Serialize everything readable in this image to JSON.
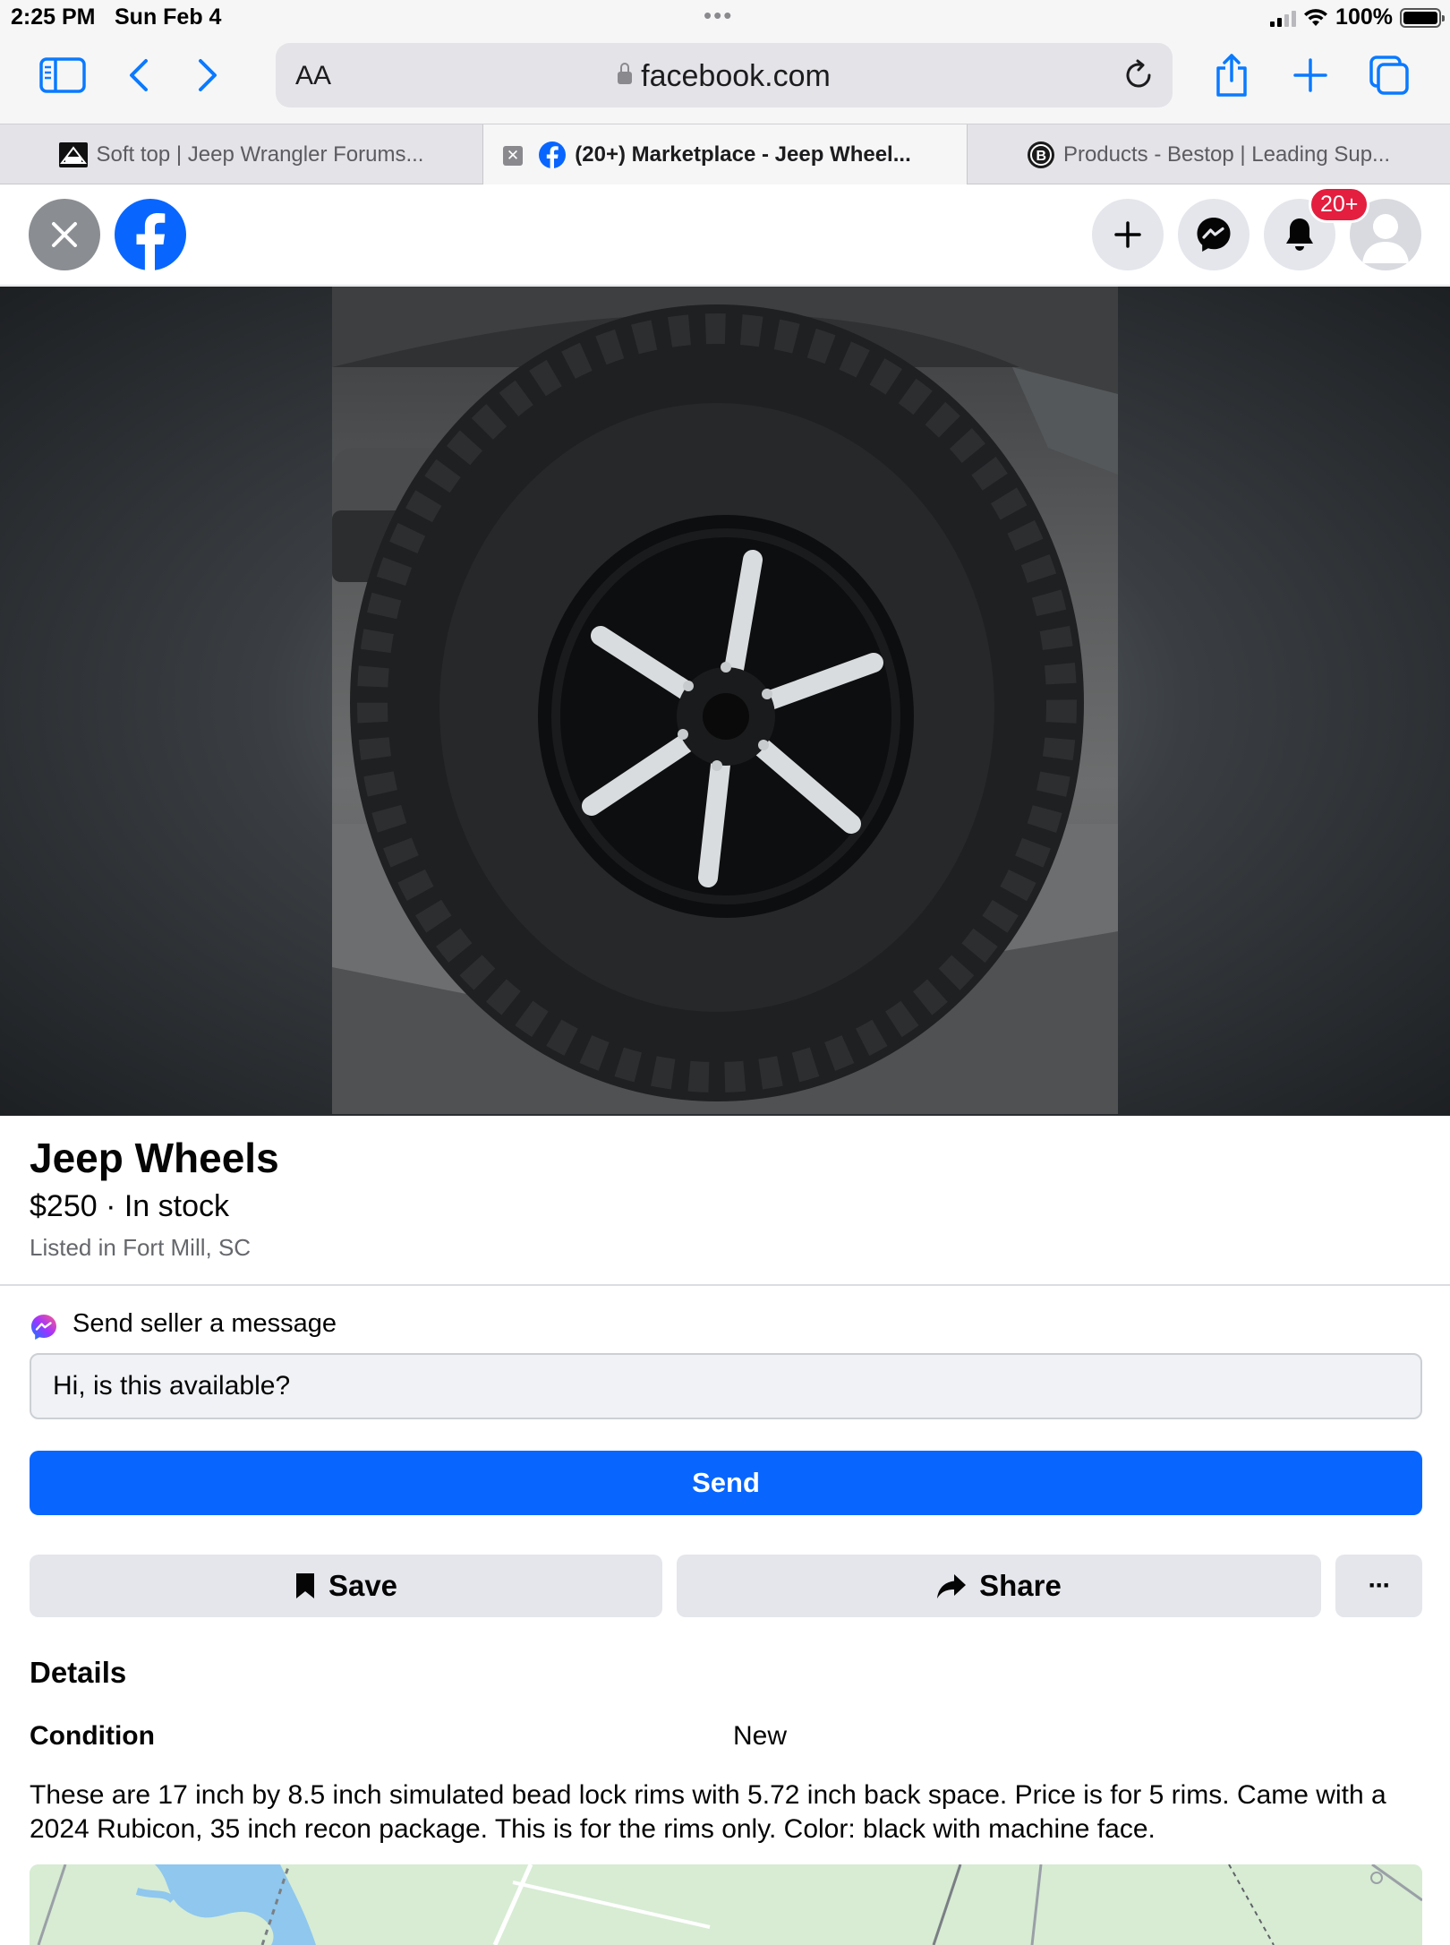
{
  "status_bar": {
    "time": "2:25 PM",
    "date": "Sun Feb 4",
    "battery": "100%"
  },
  "browser": {
    "text_size_label": "AA",
    "url": "facebook.com",
    "tabs": [
      {
        "label": "Soft top | Jeep Wrangler Forums...",
        "active": false
      },
      {
        "label": "(20+) Marketplace - Jeep Wheel...",
        "active": true
      },
      {
        "label": "Products - Bestop | Leading Sup...",
        "active": false
      }
    ]
  },
  "fb_header": {
    "notification_badge": "20+"
  },
  "listing": {
    "title": "Jeep Wheels",
    "price_status": "$250 · In stock",
    "location": "Listed in Fort Mill, SC"
  },
  "message": {
    "label": "Send seller a message",
    "input_value": "Hi, is this available?",
    "send_label": "Send"
  },
  "actions": {
    "save_label": "Save",
    "share_label": "Share",
    "more_label": "···"
  },
  "details": {
    "heading": "Details",
    "condition_label": "Condition",
    "condition_value": "New",
    "description": "These are 17 inch by 8.5 inch simulated bead lock rims with 5.72 inch back space.  Price is for 5 rims.  Came with a 2024 Rubicon, 35 inch recon package.  This is for the rims only.  Color: black with machine face."
  },
  "colors": {
    "fb_blue": "#0866ff",
    "badge_red": "#e41e3f",
    "safari_blue": "#0a7aff"
  }
}
